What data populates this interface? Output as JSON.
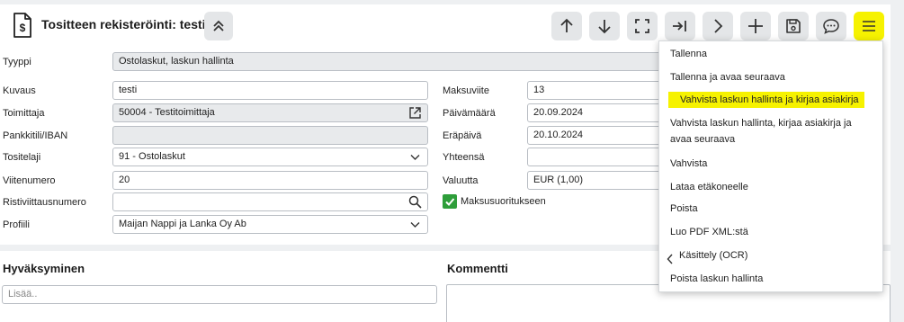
{
  "header": {
    "title": "Tositteen rekisteröinti: testi"
  },
  "toolbar": {
    "buttons": [
      "arrow-up-icon",
      "arrow-down-icon",
      "fullscreen-icon",
      "skip-to-end-icon",
      "chevron-right-icon",
      "plus-icon",
      "save-icon",
      "comment-icon",
      "hamburger-menu-icon"
    ],
    "active_color": "#f6f200"
  },
  "form": {
    "tyyppi": {
      "label": "Tyyppi",
      "value": "Ostolaskut, laskun hallinta"
    },
    "kuvaus": {
      "label": "Kuvaus",
      "value": "testi"
    },
    "toimittaja": {
      "label": "Toimittaja",
      "value": "50004 - Testitoimittaja"
    },
    "iban": {
      "label": "Pankkitili/IBAN",
      "value": ""
    },
    "tositelaji": {
      "label": "Tositelaji",
      "value": "91 - Ostolaskut"
    },
    "viitenumero": {
      "label": "Viitenumero",
      "value": "20"
    },
    "ristiviite": {
      "label": "Ristiviittausnumero",
      "value": ""
    },
    "profiili": {
      "label": "Profiili",
      "value": "Maijan Nappi ja Lanka Oy Ab"
    },
    "maksuviite": {
      "label": "Maksuviite",
      "value": "13"
    },
    "paivamaara": {
      "label": "Päivämäärä",
      "value": "20.09.2024"
    },
    "erapaiva": {
      "label": "Eräpäivä",
      "value": "20.10.2024"
    },
    "yhteensa": {
      "label": "Yhteensä",
      "value": ""
    },
    "valuutta": {
      "label": "Valuutta",
      "value": "EUR (1,00)"
    },
    "maksusuoritus": {
      "label": "Maksusuoritukseen",
      "checked": true
    }
  },
  "approval": {
    "title": "Hyväksyminen",
    "add_placeholder": "Lisää.."
  },
  "comment": {
    "title": "Kommentti"
  },
  "menu": {
    "items": [
      "Tallenna",
      "Tallenna ja avaa seuraava",
      "Vahvista laskun hallinta ja kirjaa asiakirja",
      "Vahvista laskun hallinta, kirjaa asiakirja ja avaa seuraava",
      "Vahvista",
      "Lataa etäkoneelle",
      "Poista",
      "Luo PDF XML:stä",
      "Käsittely (OCR)",
      "Poista laskun hallinta"
    ],
    "highlighted_index": 2,
    "highlight_color": "#f6f200"
  }
}
